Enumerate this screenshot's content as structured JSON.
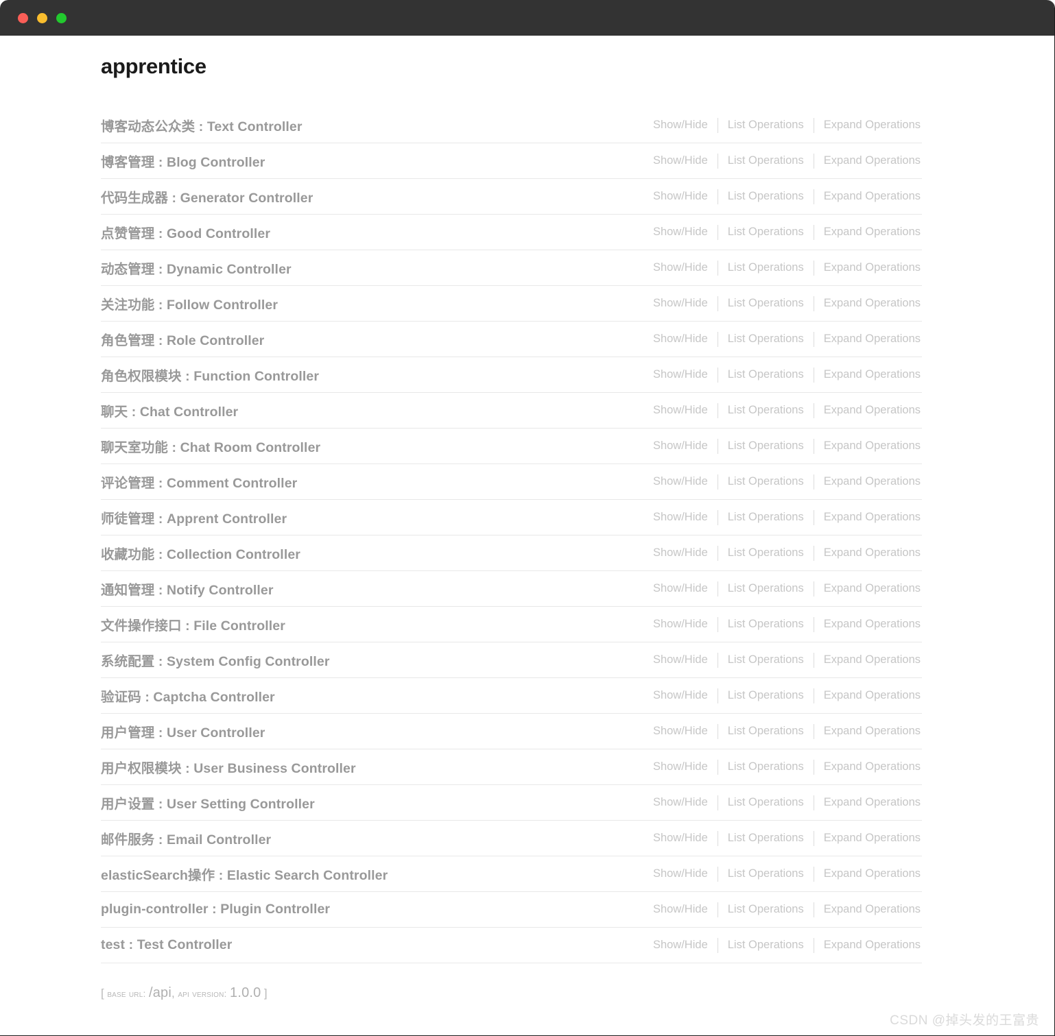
{
  "window": {
    "traffic_lights": [
      {
        "name": "close",
        "color": "#fa5e57"
      },
      {
        "name": "minimize",
        "color": "#f9bd2e"
      },
      {
        "name": "maximize",
        "color": "#22c92e"
      }
    ],
    "titlebar_color": "#333333"
  },
  "page": {
    "title": "apprentice",
    "text_color": "#999999",
    "link_color": "#c6c6c6"
  },
  "operations": {
    "show_hide": "Show/Hide",
    "list_operations": "List Operations",
    "expand_operations": "Expand Operations"
  },
  "resources": [
    {
      "label": "博客动态公众类 : Text Controller"
    },
    {
      "label": "博客管理 : Blog Controller"
    },
    {
      "label": "代码生成器 : Generator Controller"
    },
    {
      "label": "点赞管理 : Good Controller"
    },
    {
      "label": "动态管理 : Dynamic Controller"
    },
    {
      "label": "关注功能 : Follow Controller"
    },
    {
      "label": "角色管理 : Role Controller"
    },
    {
      "label": "角色权限模块 : Function Controller"
    },
    {
      "label": "聊天 : Chat Controller"
    },
    {
      "label": "聊天室功能 : Chat Room Controller"
    },
    {
      "label": "评论管理 : Comment Controller"
    },
    {
      "label": "师徒管理 : Apprent Controller"
    },
    {
      "label": "收藏功能 : Collection Controller"
    },
    {
      "label": "通知管理 : Notify Controller"
    },
    {
      "label": "文件操作接口 : File Controller"
    },
    {
      "label": "系统配置 : System Config Controller"
    },
    {
      "label": "验证码 : Captcha Controller"
    },
    {
      "label": "用户管理 : User Controller"
    },
    {
      "label": "用户权限模块 : User Business Controller"
    },
    {
      "label": "用户设置 : User Setting Controller"
    },
    {
      "label": "邮件服务 : Email Controller"
    },
    {
      "label": "elasticSearch操作 : Elastic Search Controller"
    },
    {
      "label": "plugin-controller : Plugin Controller"
    },
    {
      "label": "test : Test Controller"
    }
  ],
  "footer": {
    "open_bracket": "[",
    "base_url_label": "BASE URL:",
    "base_url_value": "/api",
    "comma": ",",
    "api_version_label": "API VERSION:",
    "api_version_value": "1.0.0",
    "close_bracket": "]"
  },
  "watermark": {
    "text": "CSDN @掉头发的王富贵"
  }
}
